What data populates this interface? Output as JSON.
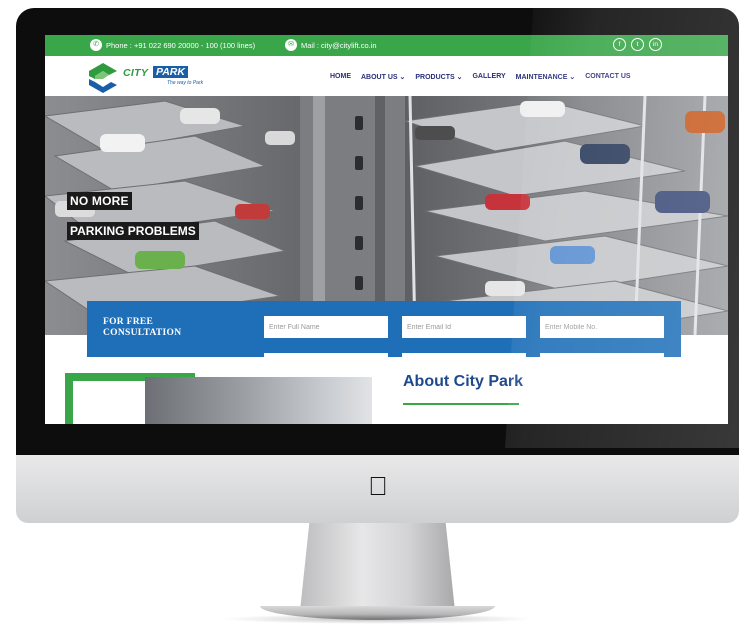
{
  "topbar": {
    "phone": "Phone : +91 022 690 20000 - 100 (100 lines)",
    "mail": "Mail : city@citylift.co.in",
    "social": [
      "f",
      "t",
      "in"
    ]
  },
  "logo": {
    "word1": "CITY",
    "word2": "PARK",
    "tagline": "The way to Park"
  },
  "nav": {
    "items": [
      "HOME",
      "ABOUT US ⌄",
      "PRODUCTS ⌄",
      "GALLERY",
      "MAINTENANCE ⌄",
      "CONTACT US"
    ]
  },
  "hero": {
    "line1": "NO MORE",
    "line2": "PARKING PROBLEMS"
  },
  "consultation": {
    "label_line1": "FOR FREE",
    "label_line2": "CONSULTATION",
    "name_placeholder": "Enter Full Name",
    "email_placeholder": "Enter Email Id",
    "mobile_placeholder": "Enter Mobile No."
  },
  "about": {
    "title": "About City Park"
  },
  "colors": {
    "green": "#3aa64a",
    "blue": "#1e6fb8",
    "navy": "#2a2f7a"
  }
}
